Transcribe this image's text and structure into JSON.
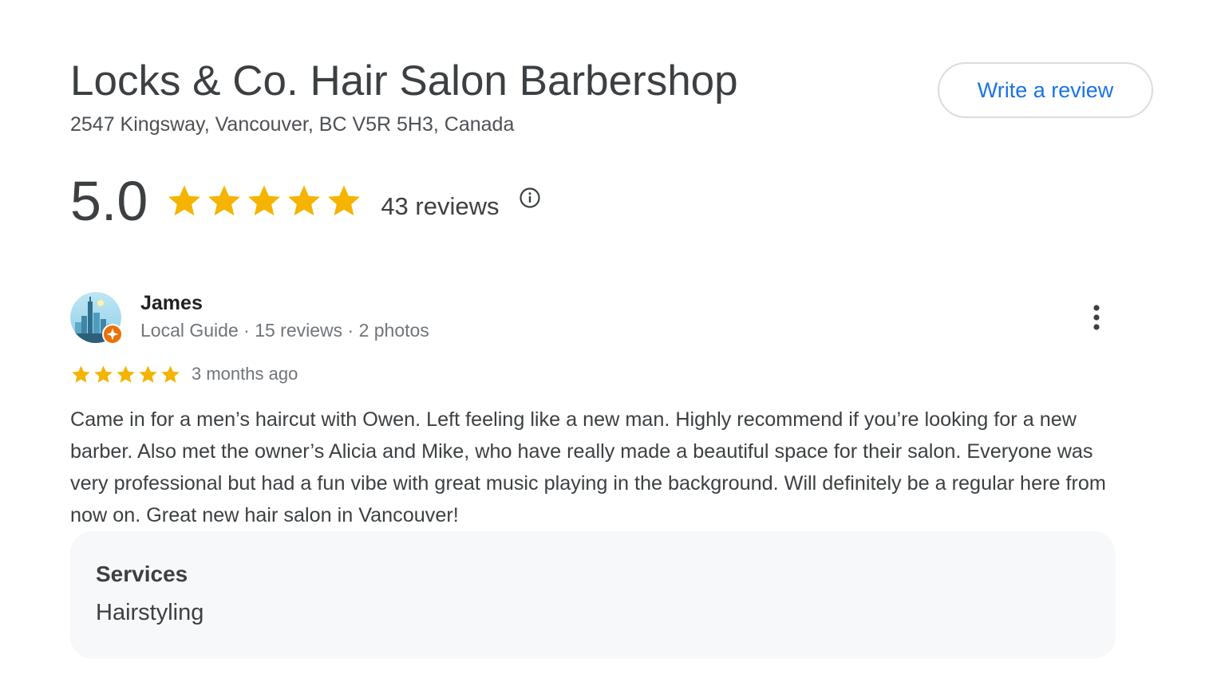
{
  "business": {
    "name": "Locks & Co. Hair Salon Barbershop",
    "address": "2547 Kingsway, Vancouver, BC V5R 5H3, Canada",
    "write_review_label": "Write a review"
  },
  "rating": {
    "value": "5.0",
    "stars": 5,
    "reviews_count": "43 reviews",
    "info_icon": "info-circle-icon"
  },
  "review": {
    "reviewer_name": "James",
    "reviewer_meta": "Local Guide · 15 reviews · 2 photos",
    "stars": 5,
    "time": "3 months ago",
    "text": "Came in for a men’s haircut with Owen. Left feeling like a new man. Highly recommend if you’re looking for a new barber. Also met the owner’s Alicia and Mike, who have really made a beautiful space for their salon. Everyone was very professional but had a fun vibe with great music playing in the background. Will definitely be a regular here from now on. Great new hair salon in Vancouver!",
    "services_heading": "Services",
    "services_value": "Hairstyling",
    "more_icon": "more-vertical-icon",
    "badge_icon": "local-guide-badge-icon"
  },
  "colors": {
    "star": "#f4b400",
    "link": "#1a73e8",
    "text": "#3c4043",
    "muted": "#70757a",
    "card_bg": "#f7f8f9",
    "badge": "#e8710a"
  }
}
